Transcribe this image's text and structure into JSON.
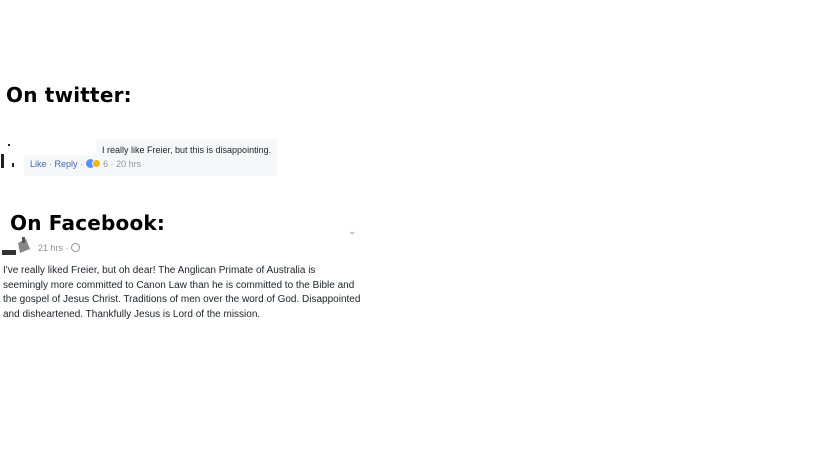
{
  "twitter_section": {
    "heading": "On twitter:",
    "comment": {
      "text": "I really like Freier, but this is disappointing.",
      "like_label": "Like",
      "reply_label": "Reply",
      "reaction_count": "6",
      "time": "20 hrs",
      "separator": "·"
    }
  },
  "facebook_section": {
    "heading": "On Facebook:",
    "post": {
      "time": "21 hrs",
      "separator": "·",
      "text": "I've really liked Freier, but oh dear! The Anglican Primate of Australia is seemingly more committed to Canon Law than he is committed to the Bible and the gospel of Jesus Christ. Traditions of men over the word of God. Disappointed and disheartened. Thankfully Jesus is Lord of the mission."
    }
  },
  "colors": {
    "link": "#4267b2",
    "meta": "#90949c",
    "comment_bg": "#f6f7f9",
    "like_reaction": "#5890ff",
    "love_reaction": "#f0ba15"
  }
}
